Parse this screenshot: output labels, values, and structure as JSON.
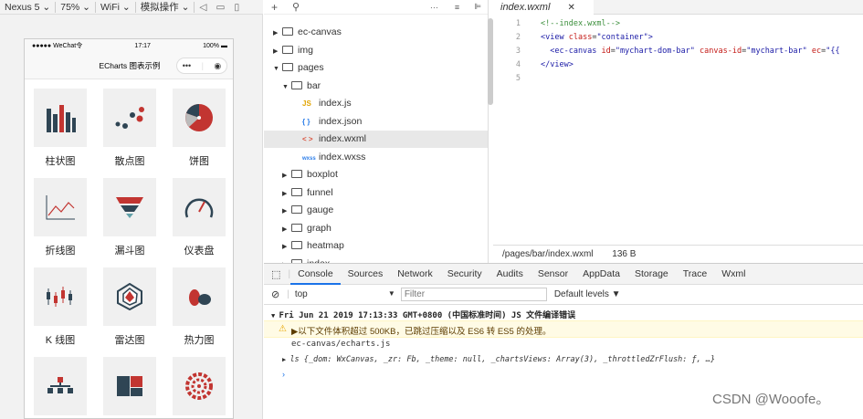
{
  "toolbar": {
    "device": "Nexus 5 ⌄",
    "zoom": "75% ⌄",
    "network": "WiFi ⌄",
    "operation": "模拟操作 ⌄"
  },
  "phone": {
    "carrier": "●●●●● WeChat令",
    "time": "17:17",
    "battery": "100% ▬",
    "nav_title": "ECharts 图表示例",
    "capsule_more": "•••",
    "capsule_close": "◉",
    "charts": [
      {
        "label": "柱状图",
        "icon": "bar-chart-icon"
      },
      {
        "label": "散点图",
        "icon": "scatter-chart-icon"
      },
      {
        "label": "饼图",
        "icon": "pie-chart-icon"
      },
      {
        "label": "折线图",
        "icon": "line-chart-icon"
      },
      {
        "label": "漏斗图",
        "icon": "funnel-chart-icon"
      },
      {
        "label": "仪表盘",
        "icon": "gauge-chart-icon"
      },
      {
        "label": "K 线图",
        "icon": "candlestick-chart-icon"
      },
      {
        "label": "雷达图",
        "icon": "radar-chart-icon"
      },
      {
        "label": "热力图",
        "icon": "heatmap-chart-icon"
      },
      {
        "label": "",
        "icon": "tree-chart-icon"
      },
      {
        "label": "",
        "icon": "treemap-chart-icon"
      },
      {
        "label": "",
        "icon": "sunburst-chart-icon"
      }
    ]
  },
  "tree": {
    "items": [
      {
        "name": "ec-canvas",
        "type": "folder",
        "open": false,
        "level": 0
      },
      {
        "name": "img",
        "type": "folder",
        "open": false,
        "level": 0
      },
      {
        "name": "pages",
        "type": "folder",
        "open": true,
        "level": 0
      },
      {
        "name": "bar",
        "type": "folder",
        "open": true,
        "level": 1
      },
      {
        "name": "index.js",
        "type": "js",
        "level": 2
      },
      {
        "name": "index.json",
        "type": "json",
        "level": 2
      },
      {
        "name": "index.wxml",
        "type": "wxml",
        "level": 2,
        "selected": true
      },
      {
        "name": "index.wxss",
        "type": "wxss",
        "level": 2
      },
      {
        "name": "boxplot",
        "type": "folder",
        "open": false,
        "level": 1
      },
      {
        "name": "funnel",
        "type": "folder",
        "open": false,
        "level": 1
      },
      {
        "name": "gauge",
        "type": "folder",
        "open": false,
        "level": 1
      },
      {
        "name": "graph",
        "type": "folder",
        "open": false,
        "level": 1
      },
      {
        "name": "heatmap",
        "type": "folder",
        "open": false,
        "level": 1
      },
      {
        "name": "index",
        "type": "folder",
        "open": false,
        "level": 1
      }
    ]
  },
  "editor": {
    "tab": "index.wxml",
    "tab_close": "✕",
    "lines": [
      "1",
      "2",
      "3",
      "4",
      "5"
    ],
    "code": {
      "l1": "<!--index.wxml-->",
      "l2a": "<view ",
      "l2b": "class",
      "l2c": "=",
      "l2d": "\"container\"",
      "l2e": ">",
      "l3a": "  <ec-canvas ",
      "l3b": "id",
      "l3c": "=",
      "l3d": "\"mychart-dom-bar\"",
      "l3e": " canvas-id",
      "l3f": "=",
      "l3g": "\"mychart-bar\"",
      "l3h": " ec",
      "l3i": "=",
      "l3j": "\"{{",
      "l4": "</view>"
    },
    "path": "/pages/bar/index.wxml",
    "size": "136 B"
  },
  "console": {
    "tabs": [
      "Console",
      "Sources",
      "Network",
      "Security",
      "Audits",
      "Sensor",
      "AppData",
      "Storage",
      "Trace",
      "Wxml"
    ],
    "context": "top",
    "filter_placeholder": "Filter",
    "levels": "Default levels ▼",
    "group_header": "Fri Jun 21 2019 17:13:33 GMT+0800 (中国标准时间) JS 文件编译错误",
    "warning": "▶以下文件体积超过 500KB，已跳过压缩以及 ES6 转 ES5 的处理。",
    "file": "ec-canvas/echarts.js",
    "object_line": "ls {_dom: WxCanvas, _zr: Fb, _theme: null, _chartsViews: Array(3), _throttledZrFlush: ƒ, …}"
  },
  "watermark": "CSDN @Wooofe。",
  "colors": {
    "accent": "#1a73e8",
    "chart_dark": "#2f4554",
    "chart_red": "#c23531"
  }
}
